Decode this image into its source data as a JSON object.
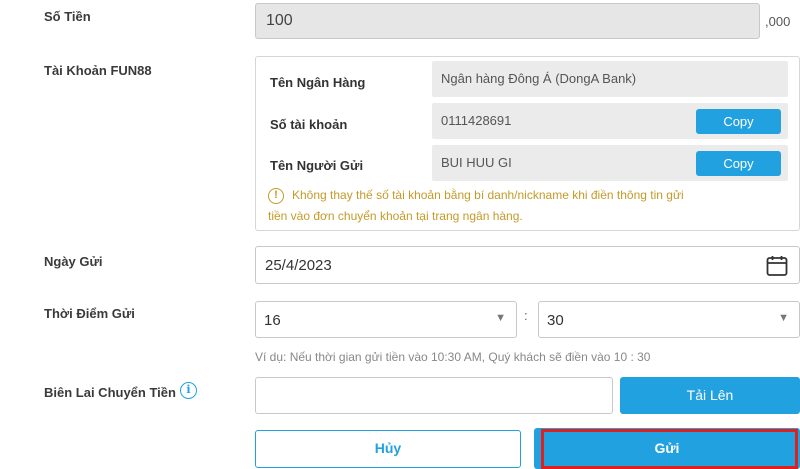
{
  "amount": {
    "label": "Số Tiền",
    "value": "100",
    "suffix": ",000"
  },
  "account": {
    "label": "Tài Khoản FUN88",
    "bank_name_label": "Tên Ngân Hàng",
    "bank_name_value": "Ngân hàng Đông Á (DongA Bank)",
    "account_number_label": "Số tài khoản",
    "account_number_value": "0111428691",
    "sender_name_label": "Tên Người Gửi",
    "sender_name_value": "BUI HUU GI",
    "copy_label": "Copy",
    "warning_icon": "!",
    "warning_line1": "Không thay thế số tài khoản bằng bí danh/nickname khi điền thông tin gửi",
    "warning_line2": "tiền vào đơn chuyển khoản tại trang ngân hàng."
  },
  "deposit_date": {
    "label": "Ngày Gửi",
    "value": "25/4/2023"
  },
  "deposit_time": {
    "label": "Thời Điểm Gửi",
    "hour": "16",
    "separator": ":",
    "minute": "30",
    "hint": "Ví dụ: Nếu thời gian gửi tiền vào 10:30 AM, Quý khách sẽ điền vào 10 : 30"
  },
  "receipt": {
    "label": "Biên Lai Chuyển Tiền",
    "info_icon": "i",
    "upload_label": "Tải Lên"
  },
  "actions": {
    "cancel_label": "Hủy",
    "submit_label": "Gửi"
  },
  "colors": {
    "accent": "#22a1e0",
    "warning": "#c49a28",
    "highlight": "#e0201c"
  }
}
